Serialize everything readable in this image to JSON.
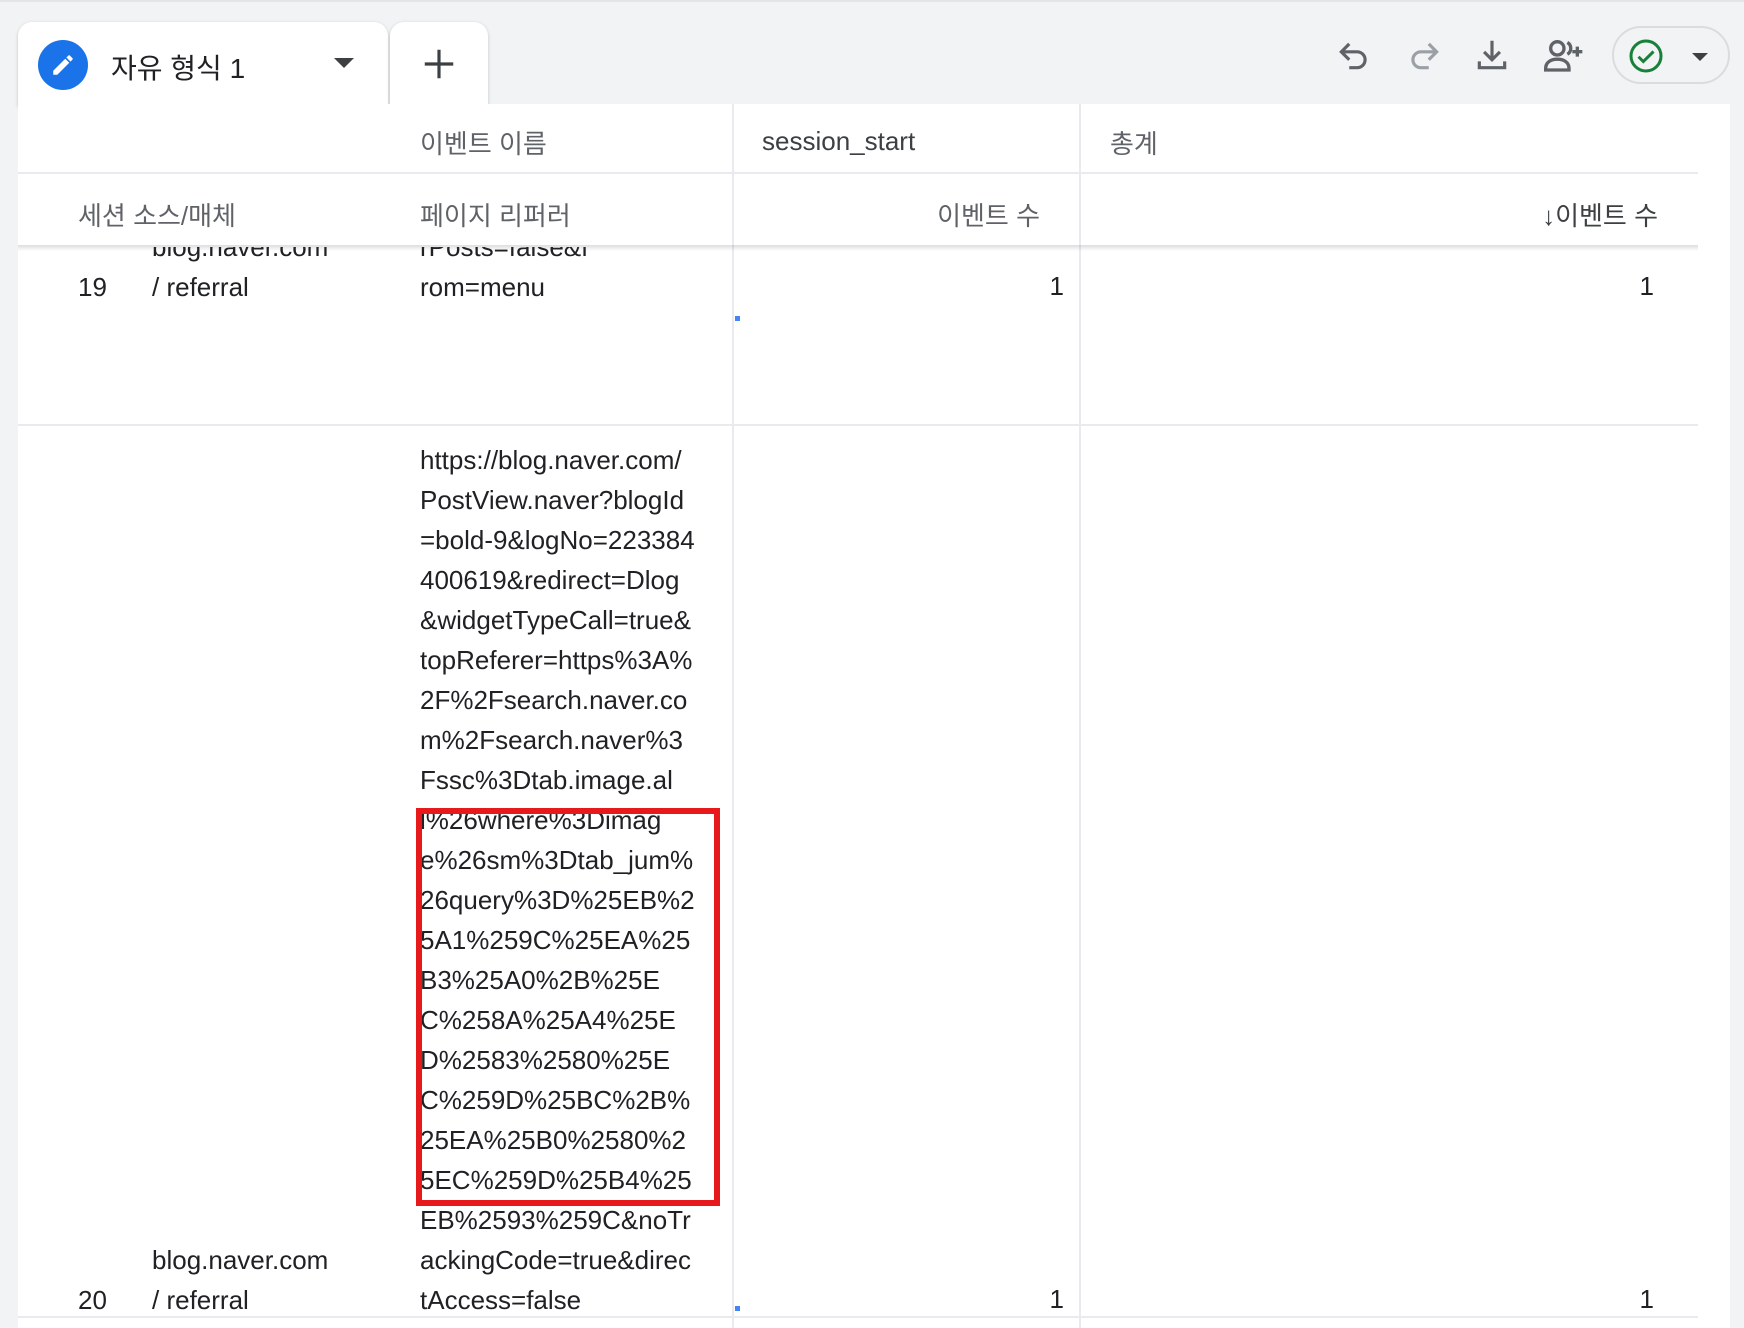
{
  "toolbar": {
    "tab_label": "자유 형식 1"
  },
  "table": {
    "header_row1": {
      "dimension2_title": "이벤트 이름",
      "metric_col1": "session_start",
      "metric_col2": "총계"
    },
    "header_row2": {
      "dimension1": "세션 소스/매체",
      "dimension2": "페이지 리퍼러",
      "metric1": "이벤트 수",
      "metric2": "↓이벤트 수"
    },
    "rows": [
      {
        "index": "19",
        "source_partial": "blog.naver.com",
        "source_tail": "/ referral",
        "referrer_partial": "rPosts=false&f",
        "referrer_tail": "rom=menu",
        "count": "1",
        "total": "1"
      },
      {
        "index": "20",
        "source_line1": "blog.naver.com",
        "source_line2": "/ referral",
        "referrer": "https://blog.naver.com/PostView.naver?blogId=bold-9&logNo=223384400619&redirect=Dlog&widgetTypeCall=true&topReferer=https%3A%2F%2Fsearch.naver.com%2Fsearch.naver%3Fssc%3Dtab.image.all%26where%3Dimage%26sm%3Dtab_jum%26query%3D%25EB%25A1%259C%25EA%25B3%25A0%2B%25EC%258A%25A4%25ED%2583%2580%25EC%259D%25BC%2B%25EA%25B0%2580%25EC%259D%25B4%25EB%2593%259C&noTrackingCode=true&directAccess=false",
        "count": "1",
        "total": "1"
      }
    ]
  }
}
